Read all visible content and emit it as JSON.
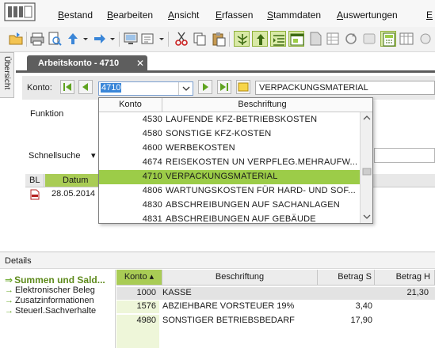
{
  "menu": {
    "items": [
      "Bestand",
      "Bearbeiten",
      "Ansicht",
      "Erfassen",
      "Stammdaten",
      "Auswertungen",
      "E"
    ]
  },
  "side_tab": {
    "label": "Übersicht"
  },
  "doc_tab": {
    "label": "Arbeitskonto - 4710",
    "close": "✕"
  },
  "konto_row": {
    "label": "Konto:",
    "value": "4710",
    "description": "VERPACKUNGSMATERIAL"
  },
  "form": {
    "funktion_label": "Funktion",
    "schnellsuche_label": "Schnellsuche",
    "schnellsuche_arrow": "▾"
  },
  "small_list": {
    "col_bl": "BL",
    "col_datum": "Datum",
    "rows": [
      {
        "datum": "28.05.2014"
      }
    ]
  },
  "dropdown": {
    "col_konto": "Konto",
    "col_beschriftung": "Beschriftung",
    "rows": [
      {
        "konto": "4530",
        "text": "LAUFENDE KFZ-BETRIEBSKOSTEN"
      },
      {
        "konto": "4580",
        "text": "SONSTIGE KFZ-KOSTEN"
      },
      {
        "konto": "4600",
        "text": "WERBEKOSTEN"
      },
      {
        "konto": "4674",
        "text": "REISEKOSTEN UN VERPFLEG.MEHRAUFW..."
      },
      {
        "konto": "4710",
        "text": "VERPACKUNGSMATERIAL",
        "selected": true
      },
      {
        "konto": "4806",
        "text": "WARTUNGSKOSTEN FÜR HARD- UND SOF..."
      },
      {
        "konto": "4830",
        "text": "ABSCHREIBUNGEN AUF SACHANLAGEN"
      },
      {
        "konto": "4831",
        "text": "ABSCHREIBUNGEN AUF GEBÄUDE"
      }
    ]
  },
  "details": {
    "title": "Details",
    "nav": [
      {
        "label": "Summen und Sald...",
        "active": true
      },
      {
        "label": "Elektronischer Beleg"
      },
      {
        "label": "Zusatzinformationen"
      },
      {
        "label": "Steuerl.Sachverhalte"
      }
    ],
    "grid": {
      "col_konto": "Konto",
      "col_beschriftung": "Beschriftung",
      "col_betrag_s": "Betrag S",
      "col_betrag_h": "Betrag H",
      "rows": [
        {
          "konto": "1000",
          "text": "KASSE",
          "betrag_s": "",
          "betrag_h": "21,30"
        },
        {
          "konto": "1576",
          "text": "ABZIEHBARE VORSTEUER 19%",
          "betrag_s": "3,40",
          "betrag_h": ""
        },
        {
          "konto": "4980",
          "text": "SONSTIGER BETRIEBSBEDARF",
          "betrag_s": "17,90",
          "betrag_h": ""
        }
      ]
    }
  },
  "colors": {
    "accent_green": "#9ccc48",
    "tab_dark": "#5e5e5e",
    "selection_blue": "#3a86d8"
  }
}
